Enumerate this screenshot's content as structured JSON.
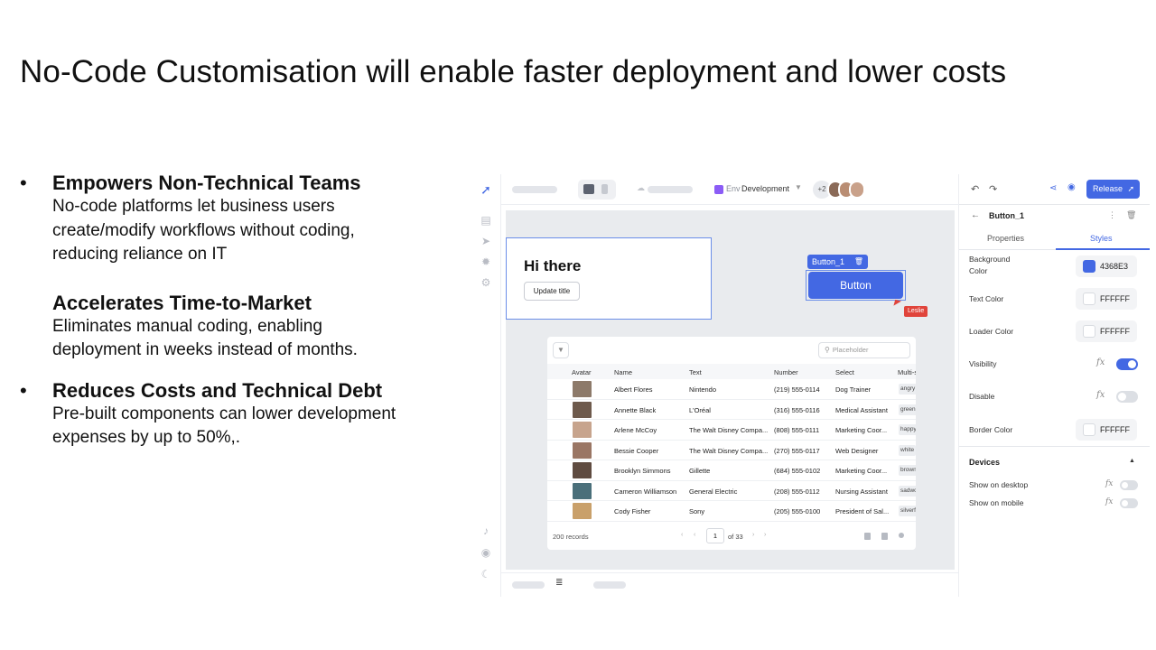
{
  "slide": {
    "title": "No-Code Customisation will enable faster deployment and lower costs",
    "bullets": [
      {
        "heading": "Empowers Non-Technical Teams",
        "lines": [
          "No-code platforms let business users",
          "create/modify workflows without coding,",
          "reducing reliance on IT"
        ],
        "sub": {
          "heading": "Accelerates Time-to-Market",
          "lines": [
            "Eliminates manual coding, enabling",
            "deployment in weeks instead of months."
          ]
        }
      },
      {
        "heading": "Reduces Costs and Technical Debt",
        "lines": [
          "Pre-built components can lower development",
          "expenses by up to 50%,."
        ]
      }
    ]
  },
  "app": {
    "topbar": {
      "env_label": "Env",
      "env_value": "Development",
      "avatar_more": "+2"
    },
    "canvas": {
      "hi_title": "Hi there",
      "update_button": "Update title",
      "selected_tag": "Button_1",
      "button_label": "Button",
      "cursor_user": "Leslie"
    },
    "table": {
      "search_placeholder": "Placeholder",
      "columns": [
        "Avatar",
        "Name",
        "Text",
        "Number",
        "Select",
        "Multi-s"
      ],
      "rows": [
        {
          "name": "Albert Flores",
          "text": "Nintendo",
          "number": "(219) 555-0114",
          "select": "Dog Trainer",
          "multi": "angry"
        },
        {
          "name": "Annette Black",
          "text": "L'Oréal",
          "number": "(316) 555-0116",
          "select": "Medical Assistant",
          "multi": "greenl"
        },
        {
          "name": "Arlene McCoy",
          "text": "The Walt Disney Compa...",
          "number": "(808) 555-0111",
          "select": "Marketing Coor...",
          "multi": "happy"
        },
        {
          "name": "Bessie Cooper",
          "text": "The Walt Disney Compa...",
          "number": "(270) 555-0117",
          "select": "Web Designer",
          "multi": "white"
        },
        {
          "name": "Brooklyn Simmons",
          "text": "Gillette",
          "number": "(684) 555-0102",
          "select": "Marketing Coor...",
          "multi": "brown"
        },
        {
          "name": "Cameron Williamson",
          "text": "General Electric",
          "number": "(208) 555-0112",
          "select": "Nursing Assistant",
          "multi": "sadwo"
        },
        {
          "name": "Cody Fisher",
          "text": "Sony",
          "number": "(205) 555-0100",
          "select": "President of Sal...",
          "multi": "silverf"
        }
      ],
      "records": "200 records",
      "page": "1",
      "page_of": "of 33"
    },
    "panel": {
      "release_label": "Release",
      "component_name": "Button_1",
      "tabs": [
        "Properties",
        "Styles"
      ],
      "active_tab": "Styles",
      "props": [
        {
          "label": "Background Color",
          "value": "4368E3",
          "color": "#4368E3"
        },
        {
          "label": "Text Color",
          "value": "FFFFFF",
          "color": "#FFFFFF"
        },
        {
          "label": "Loader Color",
          "value": "FFFFFF",
          "color": "#FFFFFF"
        },
        {
          "label": "Visibility"
        },
        {
          "label": "Disable"
        },
        {
          "label": "Border Color",
          "value": "FFFFFF",
          "color": "#FFFFFF"
        }
      ],
      "devices_title": "Devices",
      "show_desktop": "Show on desktop",
      "show_mobile": "Show on mobile",
      "fx": "fx",
      "visibility_on": true,
      "disable_on": false
    },
    "colors": {
      "accent": "#4368E3",
      "cursor": "#E0443B",
      "env": "#8B5CF6"
    }
  }
}
